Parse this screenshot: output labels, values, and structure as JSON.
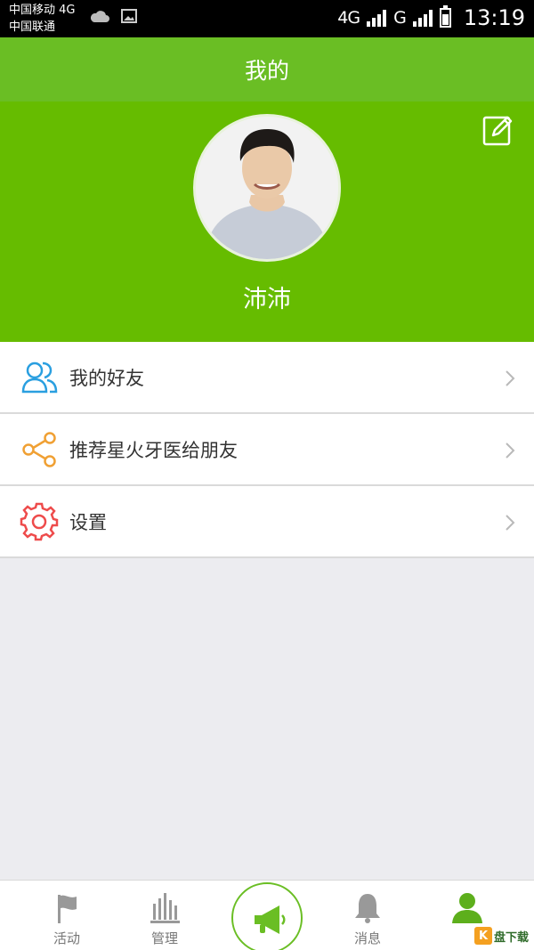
{
  "status_bar": {
    "carrier_1": "中国移动 4G",
    "carrier_2": "中国联通",
    "network_1": "4G",
    "network_2": "G",
    "time": "13:19"
  },
  "header": {
    "title": "我的"
  },
  "profile": {
    "name": "沛沛"
  },
  "menu": {
    "items": [
      {
        "label": "我的好友",
        "icon": "friends-icon",
        "color": "#2a9fe0"
      },
      {
        "label": "推荐星火牙医给朋友",
        "icon": "share-icon",
        "color": "#f0a033"
      },
      {
        "label": "设置",
        "icon": "gear-icon",
        "color": "#ee4b4b"
      }
    ]
  },
  "tabbar": {
    "tabs": [
      {
        "label": "活动",
        "icon": "flag-icon"
      },
      {
        "label": "管理",
        "icon": "bar-chart-icon"
      },
      {
        "label": "",
        "icon": "megaphone-icon"
      },
      {
        "label": "消息",
        "icon": "bell-icon"
      },
      {
        "label": "",
        "icon": "person-icon"
      }
    ]
  },
  "watermark": {
    "text": "盘下载"
  },
  "colors": {
    "accent": "#66bc00",
    "title_bar": "#6abe24"
  }
}
